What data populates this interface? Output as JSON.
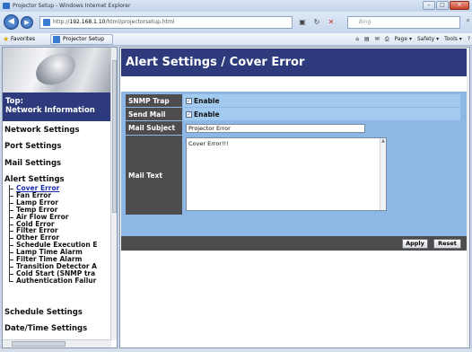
{
  "browser": {
    "window_title": "Projector Setup - Windows Internet Explorer",
    "url_prefix": "http://",
    "url_host": "192.168.1.10",
    "url_path": "/html/projectorsetup.html",
    "search_placeholder": "Bing",
    "favorites_label": "Favorites",
    "tab_title": "Projector Setup",
    "toolbar": {
      "page": "Page ▾",
      "safety": "Safety ▾",
      "tools": "Tools ▾",
      "help": "?"
    }
  },
  "nav": {
    "top_line1": "Top:",
    "top_line2": "Network Information",
    "sections": {
      "network": "Network Settings",
      "port": "Port Settings",
      "mail": "Mail Settings",
      "alert": "Alert Settings",
      "schedule": "Schedule Settings",
      "datetime": "Date/Time Settings"
    },
    "alert_items": [
      "Cover Error",
      "Fan Error",
      "Lamp Error",
      "Temp Error",
      "Air Flow Error",
      "Cold Error",
      "Filter Error",
      "Other Error",
      "Schedule Execution E",
      "Lamp Time Alarm",
      "Filter Time Alarm",
      "Transition Detector A",
      "Cold Start (SNMP tra",
      "Authentication Failur"
    ]
  },
  "main": {
    "title": "Alert Settings / Cover Error",
    "snmp_trap": {
      "label": "SNMP Trap",
      "option": "Enable",
      "checked": true
    },
    "send_mail": {
      "label": "Send Mail",
      "option": "Enable",
      "checked": true
    },
    "mail_subject": {
      "label": "Mail Subject",
      "value": "Projector Error"
    },
    "mail_text": {
      "label": "Mail Text",
      "value": "Cover Error!!!"
    },
    "apply_label": "Apply",
    "reset_label": "Reset"
  }
}
